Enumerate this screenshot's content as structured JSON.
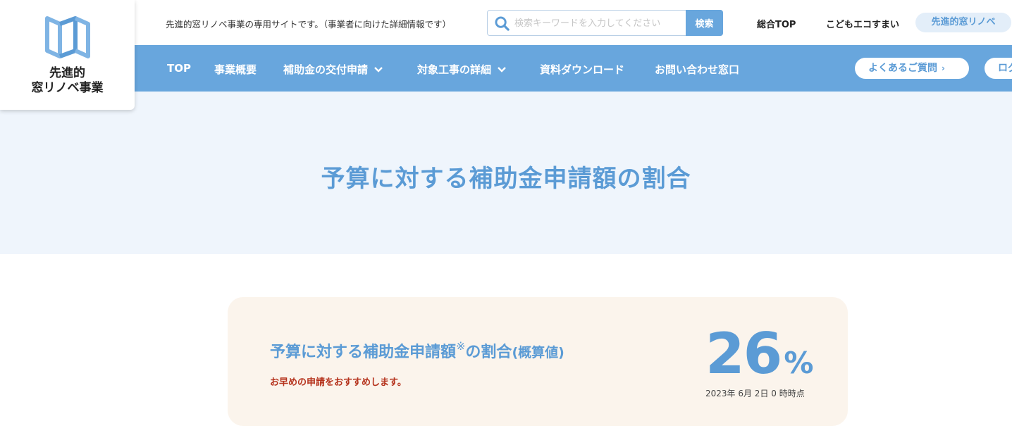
{
  "logo": {
    "line1": "先進的",
    "line2": "窓リノベ事業",
    "icon": "window-frame-icon",
    "color": "#68a6dd"
  },
  "header": {
    "tagline": "先進的窓リノベ事業の専用サイトです。（事業者に向けた詳細情報です）",
    "search": {
      "placeholder": "検索キーワードを入力してください",
      "value": "",
      "button_label": "検索"
    },
    "links": [
      "総合TOP",
      "こどもエコすまい",
      "先進的窓リノベ"
    ],
    "active_link": "先進的窓リノベ"
  },
  "nav": {
    "items": [
      {
        "label": "TOP",
        "has_dropdown": false
      },
      {
        "label": "事業概要",
        "has_dropdown": false
      },
      {
        "label": "補助金の交付申請",
        "has_dropdown": true
      },
      {
        "label": "対象工事の詳細",
        "has_dropdown": true
      },
      {
        "label": "資料ダウンロード",
        "has_dropdown": false
      },
      {
        "label": "お問い合わせ窓口",
        "has_dropdown": false
      }
    ],
    "faq_label": "よくあるご質問",
    "login_label": "ログ"
  },
  "hero": {
    "title": "予算に対する補助金申請額の割合"
  },
  "card": {
    "title": "予算に対する補助金申請額",
    "title_mark": "※",
    "title_suffix": "の割合",
    "title_paren": "(概算値)",
    "note": "お早めの申請をおすすめします。",
    "percent_value": "26",
    "percent_unit": "%",
    "as_of": "2023年 6月 2日 0 時時点"
  },
  "colors": {
    "accent": "#68a6dd",
    "accent_text": "#5b9bd5",
    "hero_bg": "#eff5fc",
    "card_bg": "#fbf4ec",
    "note_red": "#b5321c"
  }
}
